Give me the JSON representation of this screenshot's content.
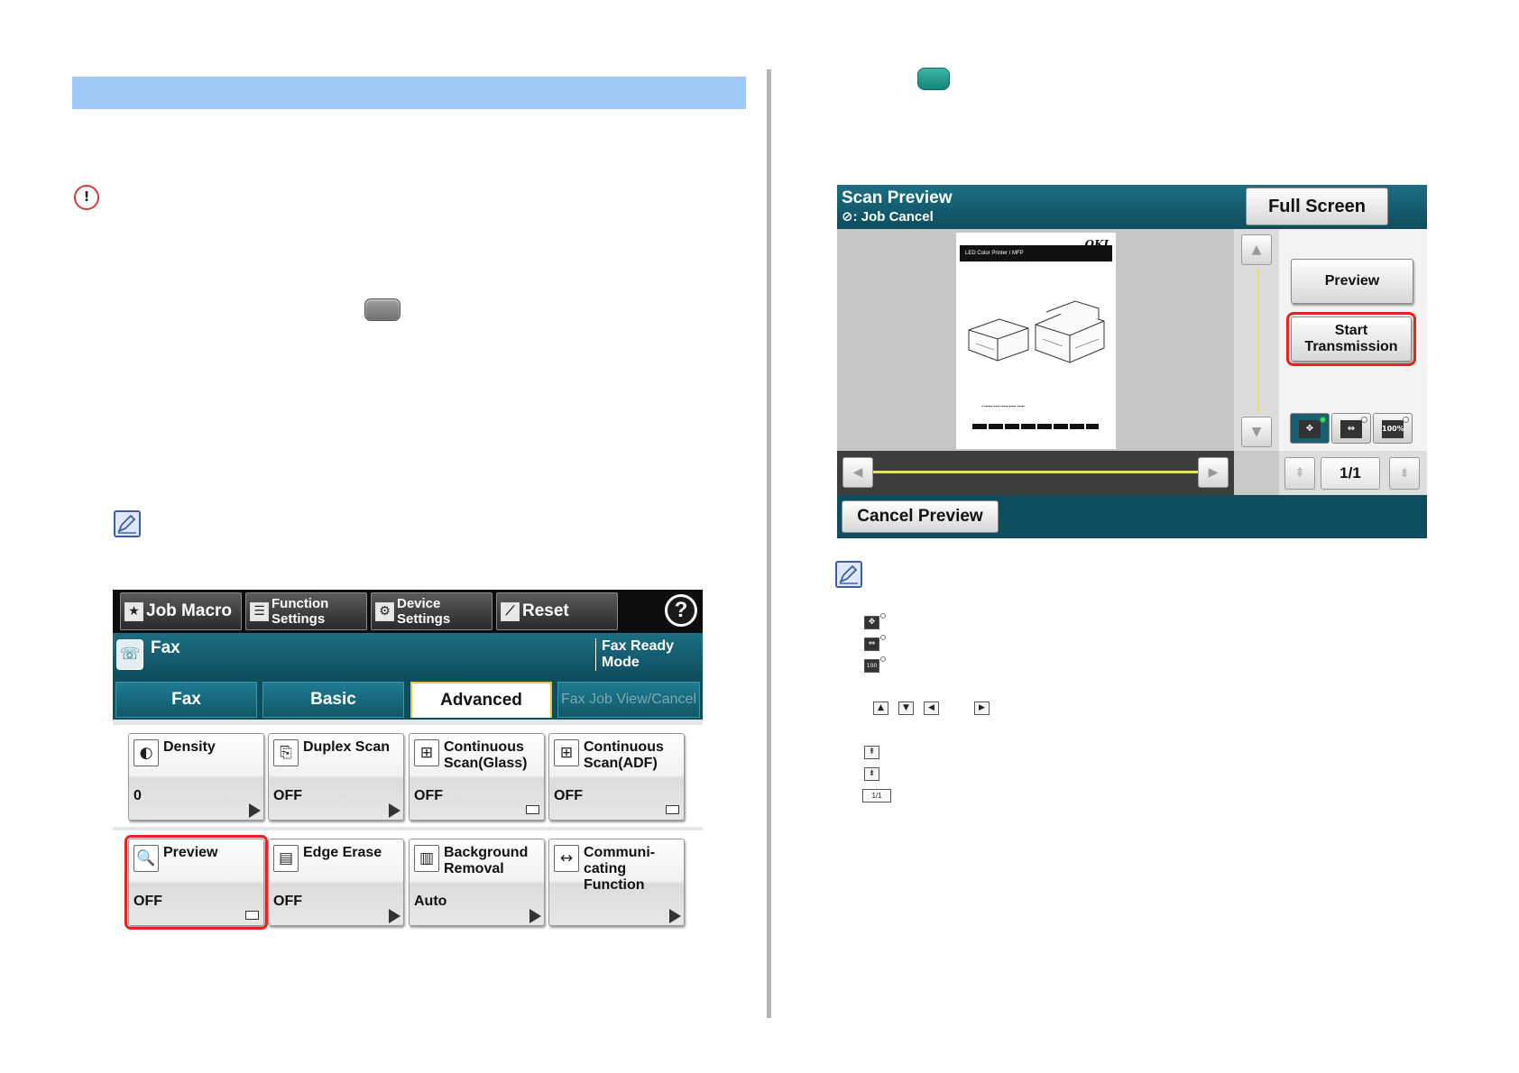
{
  "fax_panel": {
    "top_buttons": [
      {
        "label": "Job Macro",
        "icon": "star-icon"
      },
      {
        "label": "Function Settings",
        "icon": "list-icon"
      },
      {
        "label": "Device Settings",
        "icon": "gear-icon"
      },
      {
        "label": "Reset",
        "icon": "reset-icon"
      }
    ],
    "help_label": "?",
    "mode_title": "Fax",
    "status": "Fax Ready Mode",
    "tabs": [
      {
        "label": "Fax",
        "state": "normal"
      },
      {
        "label": "Basic",
        "state": "normal"
      },
      {
        "label": "Advanced",
        "state": "active"
      },
      {
        "label": "Fax Job View/Cancel",
        "state": "dimmed"
      }
    ],
    "tiles": [
      {
        "name": "Density",
        "value": "0",
        "icon": "density-icon",
        "indicator": "arrow"
      },
      {
        "name": "Duplex Scan",
        "value": "OFF",
        "icon": "duplex-icon",
        "indicator": "arrow"
      },
      {
        "name": "Continuous Scan(Glass)",
        "value": "OFF",
        "icon": "continuous-glass-icon",
        "indicator": "box"
      },
      {
        "name": "Continuous Scan(ADF)",
        "value": "OFF",
        "icon": "continuous-adf-icon",
        "indicator": "box"
      },
      {
        "name": "Preview",
        "value": "OFF",
        "icon": "preview-icon",
        "indicator": "box",
        "highlighted": true
      },
      {
        "name": "Edge Erase",
        "value": "OFF",
        "icon": "edge-erase-icon",
        "indicator": "arrow"
      },
      {
        "name": "Background Removal",
        "value": "Auto",
        "icon": "background-removal-icon",
        "indicator": "arrow"
      },
      {
        "name": "Communi- cating Function",
        "value": "",
        "icon": "communication-icon",
        "indicator": "arrow"
      }
    ]
  },
  "scan_preview": {
    "title": "Scan Preview",
    "subtitle": ": Job Cancel",
    "full_screen_label": "Full Screen",
    "preview_label": "Preview",
    "start_label": "Start Transmission",
    "page_indicator": "1/1",
    "cancel_label": "Cancel Preview",
    "zoom_level_label": "100%",
    "document": {
      "brand": "OKI",
      "band_text": "LED Color Printer / MFP"
    },
    "highlight_color": "#e52323"
  },
  "legend": {
    "page_indicator": "1/1"
  },
  "colors": {
    "title_bar": "#9ec8f5",
    "panel_teal": "#0e4d5e",
    "highlight": "#e52323",
    "scroll_line": "#e8df6c"
  }
}
